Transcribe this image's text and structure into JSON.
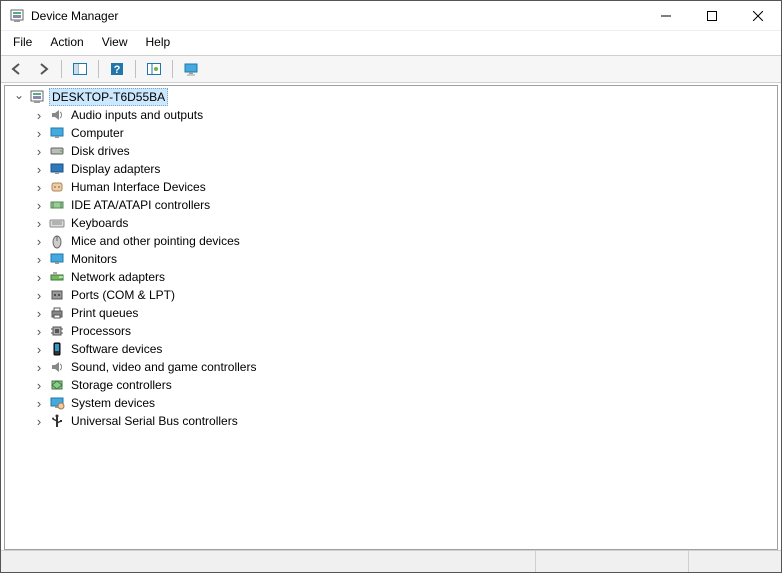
{
  "title": "Device Manager",
  "menus": [
    "File",
    "Action",
    "View",
    "Help"
  ],
  "root": {
    "label": "DESKTOP-T6D55BA",
    "expanded": true
  },
  "categories": [
    {
      "label": "Audio inputs and outputs",
      "icon": "audio"
    },
    {
      "label": "Computer",
      "icon": "computer"
    },
    {
      "label": "Disk drives",
      "icon": "disk"
    },
    {
      "label": "Display adapters",
      "icon": "display"
    },
    {
      "label": "Human Interface Devices",
      "icon": "hid"
    },
    {
      "label": "IDE ATA/ATAPI controllers",
      "icon": "ide"
    },
    {
      "label": "Keyboards",
      "icon": "keyboard"
    },
    {
      "label": "Mice and other pointing devices",
      "icon": "mouse"
    },
    {
      "label": "Monitors",
      "icon": "monitor"
    },
    {
      "label": "Network adapters",
      "icon": "network"
    },
    {
      "label": "Ports (COM & LPT)",
      "icon": "port"
    },
    {
      "label": "Print queues",
      "icon": "printer"
    },
    {
      "label": "Processors",
      "icon": "cpu"
    },
    {
      "label": "Software devices",
      "icon": "software"
    },
    {
      "label": "Sound, video and game controllers",
      "icon": "sound"
    },
    {
      "label": "Storage controllers",
      "icon": "storage"
    },
    {
      "label": "System devices",
      "icon": "system"
    },
    {
      "label": "Universal Serial Bus controllers",
      "icon": "usb"
    }
  ]
}
